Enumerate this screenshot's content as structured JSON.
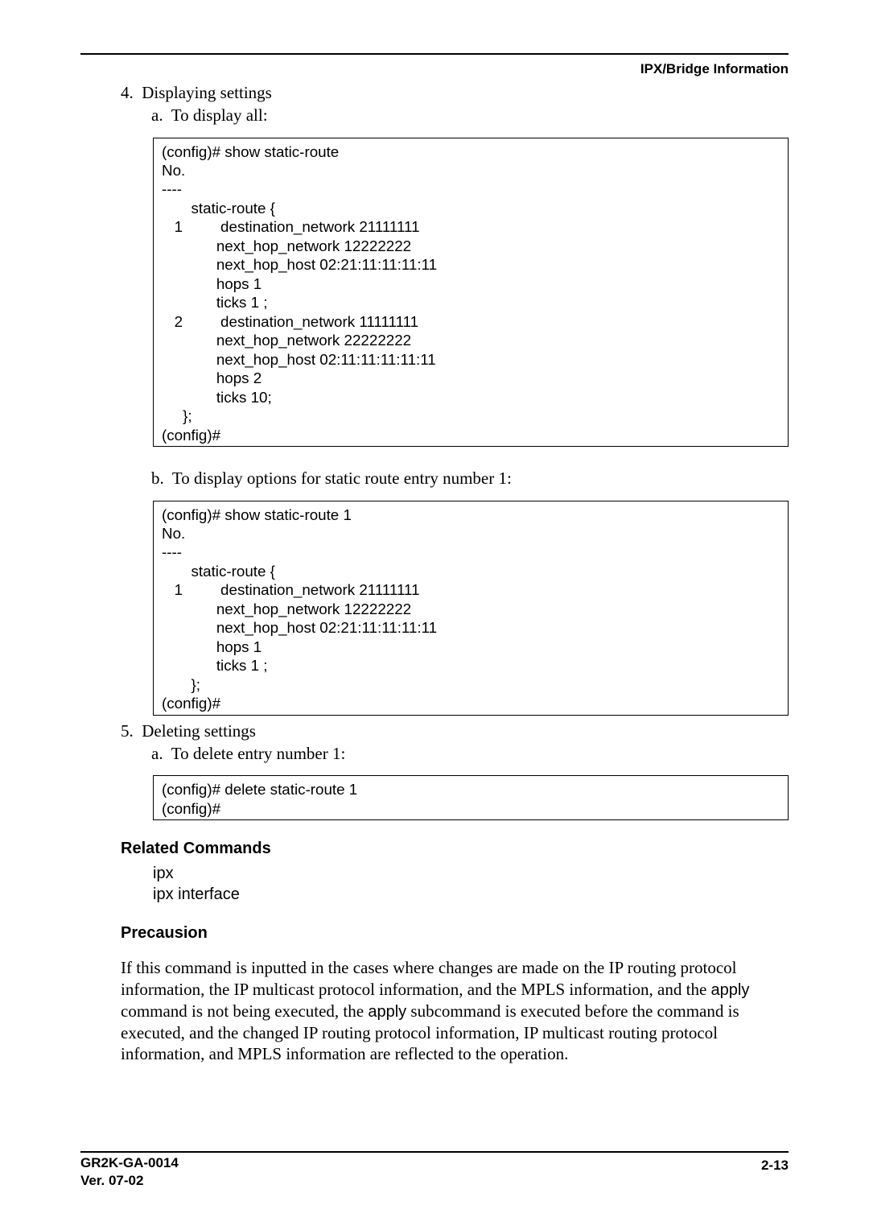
{
  "header": {
    "right": "IPX/Bridge Information"
  },
  "footer": {
    "doc": "GR2K-GA-0014",
    "ver": "Ver. 07-02",
    "page": "2-13"
  },
  "sec4": {
    "num": "4.",
    "title": "Displaying settings",
    "a_label": "a.",
    "a_text": "To display all:",
    "b_label": "b.",
    "b_text": "To display options for static route entry number 1:"
  },
  "code4a": "(config)# show static-route\nNo.\n----\n       static-route {\n   1         destination_network 21111111\n             next_hop_network 12222222\n             next_hop_host 02:21:11:11:11:11\n             hops 1\n             ticks 1 ;\n   2         destination_network 11111111\n             next_hop_network 22222222\n             next_hop_host 02:11:11:11:11:11\n             hops 2\n             ticks 10;\n     };\n(config)#",
  "code4b": "(config)# show static-route 1\nNo.\n----\n       static-route {\n   1         destination_network 21111111\n             next_hop_network 12222222\n             next_hop_host 02:21:11:11:11:11\n             hops 1\n             ticks 1 ;\n       };\n(config)#",
  "sec5": {
    "num": "5.",
    "title": "Deleting settings",
    "a_label": "a.",
    "a_text": "To delete entry number 1:"
  },
  "code5a": "(config)# delete static-route 1\n(config)#",
  "related": {
    "heading": "Related Commands",
    "line1": "ipx",
    "line2": "ipx interface"
  },
  "precausion": {
    "heading": "Precausion",
    "text_before_apply1": "If this command is inputted in the cases where changes are made on the IP routing protocol information, the IP multicast protocol information, and the MPLS information, and the ",
    "apply1": "apply",
    "mid": " command is not being executed, the ",
    "apply2": "apply",
    "text_after_apply2": " subcommand is executed before the command is executed, and the changed IP routing protocol information, IP multicast routing protocol information, and MPLS information are reflected to the operation."
  }
}
